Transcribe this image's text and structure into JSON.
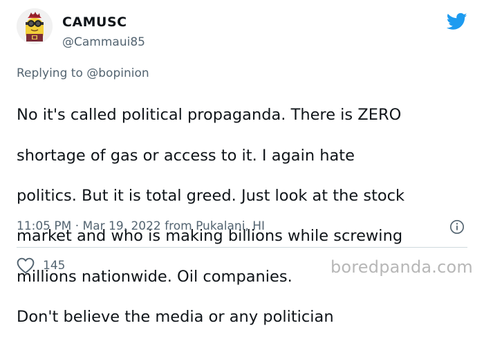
{
  "author": {
    "name": "CAMUSC",
    "handle": "@Cammaui85",
    "avatar_icon": "minion-avatar-icon"
  },
  "reply": {
    "prefix": "Replying to",
    "mention": "@bopinion"
  },
  "tweet": {
    "text": "No it's called political propaganda. There is ZERO shortage of gas or access to it. I again hate politics. But it is total greed. Just look at the stock market  and who is making billions while screwing millions nationwide. Oil companies.\nDon't believe the media or any politician",
    "lines": [
      "No it's called political propaganda. There is ZERO",
      "shortage of gas or access to it. I again hate",
      "politics. But it is total greed. Just look at the stock",
      "market  and who is making billions while screwing",
      "millions nationwide. Oil companies.",
      "Don't believe the media or any politician"
    ]
  },
  "meta": {
    "time": "11:05 PM",
    "separator": "·",
    "date": "Mar 19, 2022",
    "location": "from Pukalani, HI"
  },
  "engagement": {
    "likes": "145"
  },
  "watermark": "boredpanda.com",
  "colors": {
    "twitter_blue": "#1d9bf0",
    "secondary_text": "#536471",
    "primary_text": "#0f1419",
    "divider": "#cfd9de"
  },
  "icons": [
    "twitter-bird-icon",
    "info-icon",
    "heart-icon"
  ]
}
